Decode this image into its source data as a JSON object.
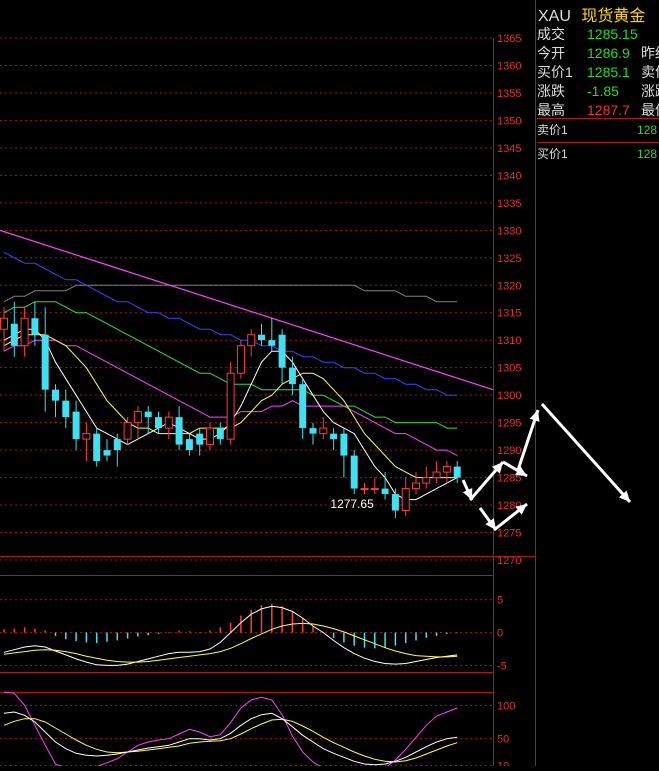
{
  "symbol": {
    "code": "XAU",
    "name": "现货黄金"
  },
  "quote": [
    {
      "label": "成交",
      "value": "1285.15",
      "color": "#22dd22",
      "extra": ""
    },
    {
      "label": "今开",
      "value": "1286.9",
      "color": "#22dd22",
      "extra": "昨结"
    },
    {
      "label": "买价1",
      "value": "1285.1",
      "color": "#22dd22",
      "extra": "卖价"
    },
    {
      "label": "涨跌",
      "value": "-1.85",
      "color": "#22dd22",
      "extra": "涨跌"
    },
    {
      "label": "最高",
      "value": "1287.7",
      "color": "#ee3333",
      "extra": "最低"
    }
  ],
  "book": [
    {
      "label": "卖价1",
      "value": "128"
    },
    {
      "label": "买价1",
      "value": "128"
    }
  ],
  "colors": {
    "up": "#ff3b3b",
    "down": "#3fe0f0",
    "grid": "#a01818",
    "ma5": "#ffffff",
    "ma10": "#ffff40",
    "ma20": "#ff40ff",
    "ma40": "#30e030",
    "ma60": "#4040ff",
    "ma120": "#808080",
    "trend": "#ff40ff"
  },
  "chart_data": {
    "type": "candlestick",
    "ylim": [
      1270,
      1365
    ],
    "yticks": [
      "1365",
      "1360",
      "1355",
      "1350",
      "1345",
      "1340",
      "1335",
      "1330",
      "1325",
      "1320",
      "1315",
      "1310",
      "1305",
      "1300",
      "1295",
      "1290",
      "1285",
      "1280",
      "1275",
      "1270"
    ],
    "low_annotation": "1277.65",
    "candles": [
      [
        1312,
        1314,
        1308,
        1316
      ],
      [
        1313,
        1309,
        1307,
        1317
      ],
      [
        1309,
        1314,
        1307,
        1316
      ],
      [
        1314,
        1311,
        1309,
        1317
      ],
      [
        1311,
        1301,
        1297,
        1316
      ],
      [
        1301,
        1299,
        1296,
        1302
      ],
      [
        1299,
        1296,
        1294,
        1301
      ],
      [
        1297,
        1292,
        1290,
        1299
      ],
      [
        1292,
        1293,
        1288,
        1295
      ],
      [
        1293,
        1288,
        1287,
        1294
      ],
      [
        1290,
        1289,
        1288,
        1292
      ],
      [
        1292,
        1290,
        1287,
        1293
      ],
      [
        1292,
        1295,
        1291,
        1296
      ],
      [
        1295,
        1297,
        1292,
        1298
      ],
      [
        1297,
        1296,
        1293,
        1298
      ],
      [
        1296,
        1294,
        1293,
        1297
      ],
      [
        1294,
        1296,
        1292,
        1297
      ],
      [
        1296,
        1291,
        1290,
        1298
      ],
      [
        1292,
        1290,
        1289,
        1293
      ],
      [
        1293,
        1291,
        1289,
        1294
      ],
      [
        1291,
        1294,
        1290,
        1295
      ],
      [
        1294,
        1292,
        1291,
        1295
      ],
      [
        1292,
        1304,
        1291,
        1306
      ],
      [
        1304,
        1309,
        1303,
        1310
      ],
      [
        1309,
        1311,
        1307,
        1312
      ],
      [
        1311,
        1310,
        1309,
        1313
      ],
      [
        1310,
        1309,
        1308,
        1314
      ],
      [
        1311,
        1305,
        1302,
        1312
      ],
      [
        1305,
        1302,
        1300,
        1307
      ],
      [
        1302,
        1294,
        1292,
        1303
      ],
      [
        1294,
        1293,
        1291,
        1295
      ],
      [
        1293,
        1294,
        1292,
        1296
      ],
      [
        1293,
        1292,
        1290,
        1294
      ],
      [
        1293,
        1289,
        1285,
        1294
      ],
      [
        1289,
        1283,
        1282,
        1290
      ],
      [
        1283,
        1283,
        1282,
        1284
      ],
      [
        1283,
        1283,
        1282,
        1285
      ],
      [
        1283,
        1282,
        1281,
        1286
      ],
      [
        1282,
        1279,
        1277.65,
        1283
      ],
      [
        1279,
        1283,
        1278,
        1285
      ],
      [
        1283,
        1284,
        1282,
        1286
      ],
      [
        1284,
        1285,
        1283,
        1287
      ],
      [
        1285,
        1286,
        1284,
        1288
      ],
      [
        1286,
        1287,
        1284,
        1288
      ],
      [
        1287,
        1285,
        1284,
        1288
      ]
    ],
    "ma5": [
      1310,
      1311,
      1312,
      1312,
      1310,
      1306,
      1303,
      1300,
      1297,
      1294,
      1293,
      1292,
      1291,
      1292,
      1293,
      1294,
      1295,
      1294,
      1293,
      1292,
      1292,
      1293,
      1295,
      1298,
      1302,
      1306,
      1308,
      1308,
      1306,
      1303,
      1300,
      1297,
      1295,
      1294,
      1293,
      1290,
      1287,
      1285,
      1282,
      1281,
      1281,
      1282,
      1283,
      1284,
      1285
    ],
    "ma10": [
      1309,
      1310,
      1311,
      1311,
      1311,
      1310,
      1309,
      1307,
      1305,
      1302,
      1299,
      1297,
      1295,
      1294,
      1294,
      1293,
      1293,
      1293,
      1293,
      1294,
      1294,
      1294,
      1294,
      1295,
      1297,
      1299,
      1300,
      1302,
      1303,
      1304,
      1304,
      1303,
      1301,
      1299,
      1296,
      1293,
      1291,
      1289,
      1287,
      1286,
      1285,
      1285,
      1285,
      1285,
      1285
    ],
    "ma20": [
      1308,
      1309,
      1309,
      1310,
      1310,
      1310,
      1309,
      1309,
      1308,
      1307,
      1306,
      1305,
      1304,
      1303,
      1302,
      1301,
      1300,
      1299,
      1298,
      1297,
      1296,
      1296,
      1296,
      1297,
      1297,
      1297,
      1298,
      1298,
      1299,
      1298,
      1298,
      1298,
      1298,
      1298,
      1297,
      1296,
      1295,
      1294,
      1293,
      1293,
      1292,
      1291,
      1290,
      1290,
      1289
    ],
    "ma40": [
      1315,
      1316,
      1316,
      1317,
      1317,
      1317,
      1316,
      1315,
      1315,
      1314,
      1313,
      1312,
      1311,
      1310,
      1309,
      1308,
      1307,
      1306,
      1305,
      1304,
      1304,
      1303,
      1302,
      1302,
      1302,
      1301,
      1301,
      1301,
      1301,
      1301,
      1300,
      1300,
      1299,
      1298,
      1298,
      1297,
      1296,
      1296,
      1295,
      1295,
      1295,
      1295,
      1295,
      1294,
      1294
    ],
    "ma60": [
      1326,
      1325,
      1324,
      1324,
      1323,
      1322,
      1321,
      1321,
      1320,
      1319,
      1318,
      1317,
      1317,
      1316,
      1315,
      1315,
      1314,
      1314,
      1313,
      1312,
      1312,
      1311,
      1311,
      1310,
      1310,
      1309,
      1309,
      1308,
      1308,
      1307,
      1307,
      1306,
      1306,
      1305,
      1305,
      1304,
      1304,
      1303,
      1303,
      1302,
      1302,
      1301,
      1301,
      1300,
      1300
    ],
    "ma120": [
      1317,
      1318,
      1318,
      1319,
      1319,
      1319,
      1319,
      1320,
      1320,
      1320,
      1320,
      1320,
      1320,
      1320,
      1320,
      1320,
      1320,
      1320,
      1320,
      1320,
      1320,
      1320,
      1320,
      1320,
      1320,
      1320,
      1320,
      1320,
      1320,
      1320,
      1320,
      1320,
      1320,
      1320,
      1320,
      1319,
      1319,
      1319,
      1319,
      1318,
      1318,
      1318,
      1317,
      1317,
      1317
    ],
    "macd": {
      "ylim": [
        -6,
        8
      ],
      "yticks": [
        "5",
        "0",
        "-5"
      ],
      "hist": [
        0.5,
        0.6,
        0.8,
        0.6,
        0.3,
        -0.5,
        -1.0,
        -1.3,
        -1.5,
        -1.6,
        -1.4,
        -1.2,
        -0.9,
        -0.6,
        -0.4,
        -0.2,
        0.1,
        0.3,
        0.2,
        0.1,
        0.3,
        0.8,
        1.5,
        2.6,
        3.5,
        4.2,
        4.4,
        4.0,
        3.3,
        2.2,
        1.0,
        0.0,
        -0.8,
        -1.5,
        -2.0,
        -2.3,
        -2.4,
        -2.3,
        -2.0,
        -1.6,
        -1.2,
        -0.8,
        -0.5,
        -0.2,
        0.1
      ],
      "dif": [
        -3.0,
        -2.6,
        -2.2,
        -2.0,
        -2.2,
        -2.8,
        -3.4,
        -4.0,
        -4.5,
        -4.9,
        -5.0,
        -5.0,
        -4.8,
        -4.4,
        -4.0,
        -3.6,
        -3.2,
        -3.0,
        -3.0,
        -2.9,
        -2.5,
        -1.5,
        0.0,
        1.5,
        2.8,
        3.6,
        4.0,
        3.8,
        3.2,
        2.2,
        1.0,
        0.0,
        -1.2,
        -2.3,
        -3.2,
        -3.9,
        -4.4,
        -4.7,
        -4.8,
        -4.7,
        -4.4,
        -4.1,
        -3.8,
        -3.6,
        -3.4
      ],
      "dea": [
        -3.3,
        -3.1,
        -2.9,
        -2.7,
        -2.6,
        -2.7,
        -2.9,
        -3.2,
        -3.6,
        -3.9,
        -4.2,
        -4.4,
        -4.5,
        -4.5,
        -4.4,
        -4.2,
        -4.0,
        -3.8,
        -3.6,
        -3.4,
        -3.2,
        -2.9,
        -2.4,
        -1.7,
        -0.9,
        -0.2,
        0.5,
        1.0,
        1.3,
        1.4,
        1.3,
        1.0,
        0.6,
        0.1,
        -0.5,
        -1.1,
        -1.7,
        -2.3,
        -2.8,
        -3.2,
        -3.5,
        -3.6,
        -3.7,
        -3.7,
        -3.6
      ]
    },
    "kdj": {
      "ylim": [
        0,
        120
      ],
      "yticks": [
        "100",
        "50",
        "10"
      ],
      "k": [
        88,
        90,
        85,
        75,
        60,
        45,
        35,
        28,
        25,
        24,
        25,
        27,
        30,
        33,
        36,
        38,
        40,
        45,
        50,
        50,
        48,
        50,
        58,
        70,
        80,
        86,
        88,
        80,
        68,
        55,
        45,
        35,
        28,
        22,
        16,
        12,
        11,
        12,
        16,
        22,
        30,
        38,
        45,
        50,
        52
      ],
      "d": [
        70,
        76,
        80,
        80,
        75,
        66,
        57,
        48,
        40,
        34,
        30,
        29,
        30,
        31,
        33,
        35,
        37,
        39,
        43,
        45,
        46,
        47,
        50,
        57,
        65,
        72,
        78,
        79,
        76,
        69,
        61,
        52,
        44,
        37,
        30,
        24,
        19,
        16,
        15,
        17,
        21,
        27,
        33,
        39,
        44
      ],
      "j": [
        120,
        118,
        100,
        70,
        40,
        12,
        6,
        4,
        6,
        8,
        14,
        20,
        30,
        40,
        45,
        48,
        50,
        57,
        64,
        60,
        53,
        56,
        74,
        96,
        108,
        112,
        108,
        86,
        54,
        30,
        15,
        6,
        4,
        4,
        4,
        4,
        4,
        6,
        18,
        34,
        52,
        70,
        84,
        90,
        96
      ]
    }
  }
}
